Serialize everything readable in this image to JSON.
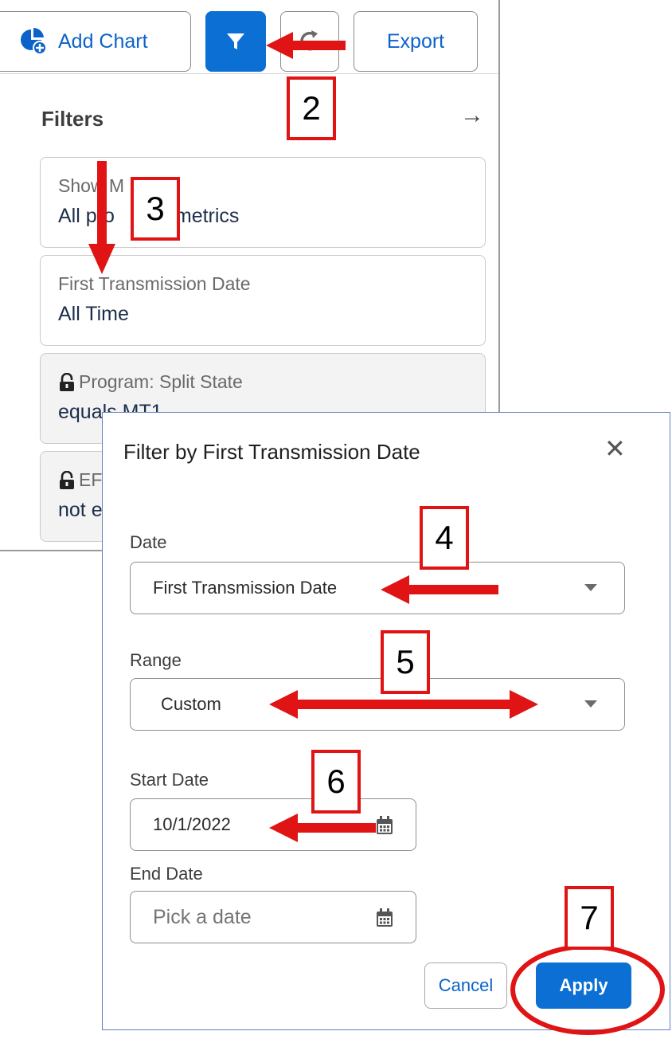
{
  "toolbar": {
    "add_chart_label": "Add Chart",
    "export_label": "Export"
  },
  "filters": {
    "title": "Filters",
    "cards": [
      {
        "label": "Show M",
        "value": "All pro",
        "value_tail": "metrics"
      },
      {
        "label": "First Transmission Date",
        "value": "All Time"
      },
      {
        "label": "Program: Split State",
        "value": "equals MT1",
        "locked": true
      },
      {
        "label": "EF",
        "value": "not e",
        "locked": true
      }
    ]
  },
  "modal": {
    "title": "Filter by First Transmission Date",
    "date_label": "Date",
    "date_value": "First Transmission Date",
    "range_label": "Range",
    "range_value": "Custom",
    "start_label": "Start Date",
    "start_value": "10/1/2022",
    "end_label": "End Date",
    "end_placeholder": "Pick a date",
    "cancel_label": "Cancel",
    "apply_label": "Apply"
  },
  "annotations": {
    "steps": [
      "2",
      "3",
      "4",
      "5",
      "6",
      "7"
    ],
    "color": "#e01414"
  },
  "colors": {
    "primary": "#0b6fd4",
    "link": "#0b63c9"
  }
}
